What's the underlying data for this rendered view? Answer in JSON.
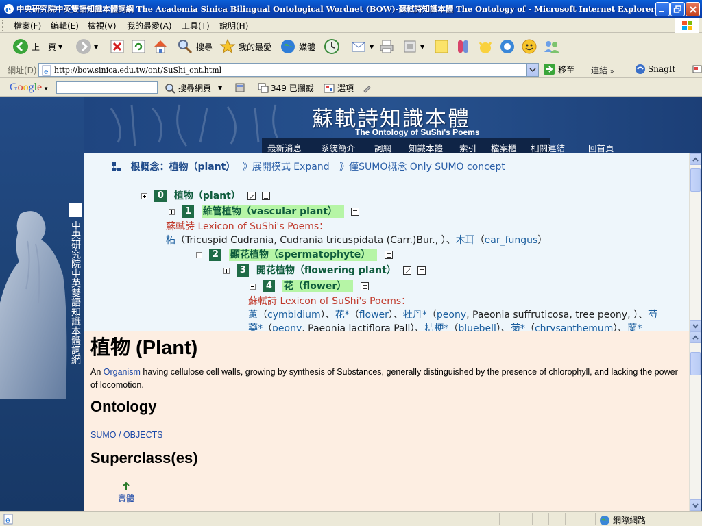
{
  "window": {
    "title": "中央研究院中英雙語知識本體詞網 The Academia Sinica Bilingual Ontological Wordnet (BOW)-蘇軾詩知識本體 The Ontology of - Microsoft Internet Explorer"
  },
  "menu": {
    "items": [
      "檔案(F)",
      "編輯(E)",
      "檢視(V)",
      "我的最愛(A)",
      "工具(T)",
      "說明(H)"
    ]
  },
  "toolbar": {
    "back_label": "上一頁",
    "search_label": "搜尋",
    "favorites_label": "我的最愛",
    "media_label": "媒體"
  },
  "address": {
    "label": "網址(D)",
    "url": "http://bow.sinica.edu.tw/ont/SuShi_ont.html",
    "go_label": "移至",
    "links_label": "連結",
    "snagit_label": "SnagIt"
  },
  "googlebar": {
    "logo": "Google",
    "search_web_label": "搜尋網頁",
    "blocked_label": "349 已攔截",
    "options_label": "選項"
  },
  "site": {
    "title_cn": "蘇軾詩知識本體",
    "title_en": "The Ontology of SuShi's Poems",
    "nav": [
      "最新消息",
      "系統簡介",
      "詞網",
      "知識本體",
      "索引",
      "檔案櫃",
      "相關連結",
      "回首頁"
    ],
    "side_title": "中央研究院中英雙語知識本體詞網"
  },
  "tree": {
    "root_label": "根概念：植物（plant）",
    "expand_label": "》展開模式 Expand",
    "sumo_label": "》僅SUMO概念 Only SUMO concept",
    "nodes": [
      {
        "level": "0",
        "label": "植物（plant）"
      },
      {
        "level": "1",
        "label": "維管植物（vascular plant）"
      },
      {
        "level": "2",
        "label": "顯花植物（spermatophyte）"
      },
      {
        "level": "3",
        "label": "開花植物（flowering plant）"
      },
      {
        "level": "4",
        "label": "花（flower）"
      }
    ],
    "lexicon_label": "蘇軾詩 Lexicon of SuShi's Poems：",
    "lexicon_1": {
      "w1": "柘",
      "w1_gloss": "（Tricuspid Cudrania, Cudrania tricuspidata (Carr.)Bur., ）、",
      "w2": "木耳",
      "w2_open": "（",
      "w2_link": "ear_fungus",
      "w2_close": "）"
    },
    "lexicon_4_line1": {
      "a": "蕙",
      "a_open": "（",
      "a_link": "cymbidium",
      "a_close": "）、",
      "b": "花*",
      "b_open": "（",
      "b_link": "flower",
      "b_close": "）、",
      "c": "牡丹*",
      "c_open": "（",
      "c_link": "peony",
      "c_rest": ", Paeonia suffruticosa, tree peony, ）、",
      "d": "芍"
    },
    "lexicon_4_line2": {
      "a": "藥*",
      "a_open": "（",
      "a_link": "peony",
      "a_rest": ", Paeonia lactiflora Pall）、",
      "b": "桔梗*",
      "b_open": "（",
      "b_link": "bluebell",
      "b_close": "）、",
      "c": "菊*",
      "c_open": "（",
      "c_link": "chrysanthemum",
      "c_close": "）、",
      "d": "蘭*"
    }
  },
  "description": {
    "heading": "植物 (Plant)",
    "def_prefix": "An ",
    "def_link": "Organism",
    "def_rest": " having cellulose cell walls, growing by synthesis of Substances, generally distinguished by the presence of chlorophyll, and lacking the power of locomotion.",
    "ontology_heading": "Ontology",
    "ontology_path_1": "SUMO",
    "ontology_path_sep": " / ",
    "ontology_path_2": "OBJECTS",
    "superclass_heading": "Superclass(es)",
    "superclass_entity": "實體"
  },
  "status": {
    "zone_label": "網際網路"
  },
  "colors": {
    "accent_green": "#1f6b46",
    "highlight": "#b6f5a6",
    "banner_blue": "#234b86",
    "link_blue": "#1e4aa8",
    "lexicon_red": "#c0392b"
  }
}
